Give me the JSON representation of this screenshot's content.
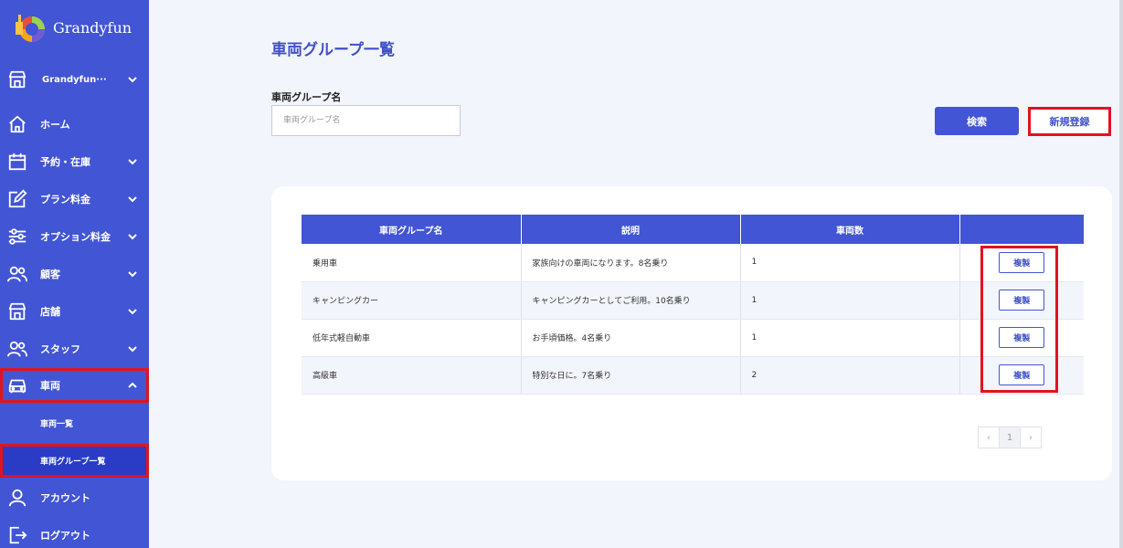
{
  "brand": {
    "name": "Grandyfun"
  },
  "store": {
    "label": "Grandyfun···"
  },
  "nav": [
    {
      "key": "home",
      "label": "ホーム"
    },
    {
      "key": "reservations",
      "label": "予約・在庫"
    },
    {
      "key": "plan-pricing",
      "label": "プラン料金"
    },
    {
      "key": "option-pricing",
      "label": "オプション料金"
    },
    {
      "key": "customers",
      "label": "顧客"
    },
    {
      "key": "stores",
      "label": "店舗"
    },
    {
      "key": "staff",
      "label": "スタッフ"
    },
    {
      "key": "vehicles",
      "label": "車両"
    }
  ],
  "vehicle_sub": [
    {
      "label": "車両一覧"
    },
    {
      "label": "車両グループ一覧"
    }
  ],
  "bottom_nav": [
    {
      "label": "アカウント"
    },
    {
      "label": "ログアウト"
    }
  ],
  "page": {
    "title": "車両グループ一覧",
    "field_label": "車両グループ名",
    "search_placeholder": "車両グループ名",
    "search_button": "検索",
    "new_button": "新規登録"
  },
  "table": {
    "headers": [
      "車両グループ名",
      "説明",
      "車両数",
      ""
    ],
    "rows": [
      {
        "name": "乗用車",
        "description": "家族向けの車両になります。8名乗り",
        "count": "1",
        "action": "複製"
      },
      {
        "name": "キャンピングカー",
        "description": "キャンピングカーとしてご利用。10名乗り",
        "count": "1",
        "action": "複製"
      },
      {
        "name": "低年式軽自動車",
        "description": "お手頃価格。4名乗り",
        "count": "1",
        "action": "複製"
      },
      {
        "name": "高級車",
        "description": "特別な日に。7名乗り",
        "count": "2",
        "action": "複製"
      }
    ]
  },
  "pagination": {
    "prev": "‹",
    "current": "1",
    "next": "›"
  },
  "colors": {
    "primary": "#4255d4",
    "highlight": "#e0141e"
  }
}
